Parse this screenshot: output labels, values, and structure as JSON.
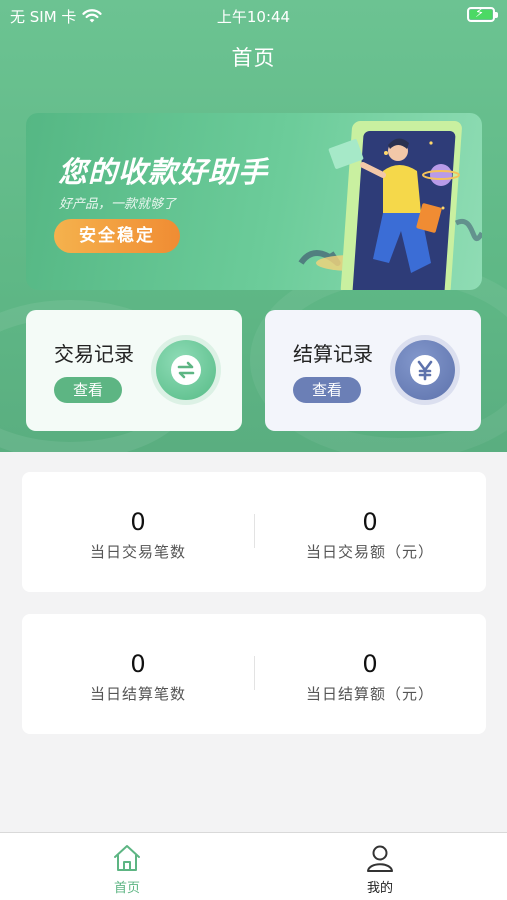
{
  "status_bar": {
    "carrier": "无 SIM 卡",
    "time": "上午10:44"
  },
  "nav": {
    "title": "首页"
  },
  "banner": {
    "title": "您的收款好助手",
    "subtitle": "好产品，一款就够了",
    "button": "安全稳定"
  },
  "quick_cards": [
    {
      "title": "交易记录",
      "button": "查看",
      "icon": "exchange-icon"
    },
    {
      "title": "结算记录",
      "button": "查看",
      "icon": "yen-icon"
    }
  ],
  "stats": [
    {
      "value": "0",
      "label": "当日交易笔数"
    },
    {
      "value": "0",
      "label": "当日交易额（元）"
    },
    {
      "value": "0",
      "label": "当日结算笔数"
    },
    {
      "value": "0",
      "label": "当日结算额（元）"
    }
  ],
  "tabbar": [
    {
      "label": "首页",
      "icon": "home-icon",
      "active": true
    },
    {
      "label": "我的",
      "icon": "user-icon",
      "active": false
    }
  ],
  "colors": {
    "primary": "#5fb886",
    "accent_orange": "#f5a340",
    "settlement_blue": "#6b7fb6"
  }
}
